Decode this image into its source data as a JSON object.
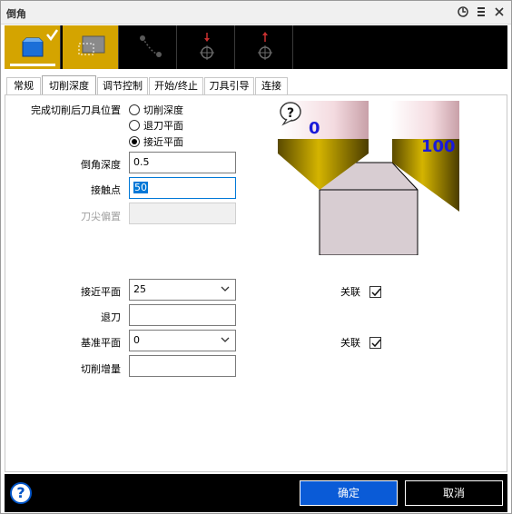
{
  "window": {
    "title": "倒角"
  },
  "titlebar_icons": [
    "pin-icon",
    "menu-icon",
    "close-icon"
  ],
  "tabs": [
    {
      "label": "常规"
    },
    {
      "label": "切削深度"
    },
    {
      "label": "调节控制"
    },
    {
      "label": "开始/终止"
    },
    {
      "label": "刀具引导"
    },
    {
      "label": "连接"
    }
  ],
  "active_tab": 1,
  "form": {
    "finish_position_label": "完成切削后刀具位置",
    "finish_options": [
      {
        "label": "切削深度",
        "checked": false
      },
      {
        "label": "退刀平面",
        "checked": false
      },
      {
        "label": "接近平面",
        "checked": true
      }
    ],
    "chamfer_depth_label": "倒角深度",
    "chamfer_depth_value": "0.5",
    "contact_point_label": "接触点",
    "contact_point_value": "50",
    "tip_offset_label": "刀尖偏置",
    "tip_offset_value": "",
    "approach_plane_label": "接近平面",
    "approach_plane_value": "25",
    "retract_label": "退刀",
    "retract_value": "",
    "base_plane_label": "基准平面",
    "base_plane_value": "0",
    "cut_increment_label": "切削增量",
    "cut_increment_value": "",
    "assoc_label_1": "关联",
    "assoc_label_2": "关联",
    "assoc_1_checked": true,
    "assoc_2_checked": true
  },
  "illustration": {
    "left_value": "0",
    "right_value": "100",
    "help_glyph": "?"
  },
  "footer": {
    "help_glyph": "?",
    "ok_label": "确定",
    "cancel_label": "取消"
  },
  "colors": {
    "accent_gold": "#d4a400",
    "toolbar_bg": "#000000",
    "ok_blue": "#0a5bd7",
    "value_blue": "#1a1ad8",
    "tool_gold": "#8a7200"
  }
}
